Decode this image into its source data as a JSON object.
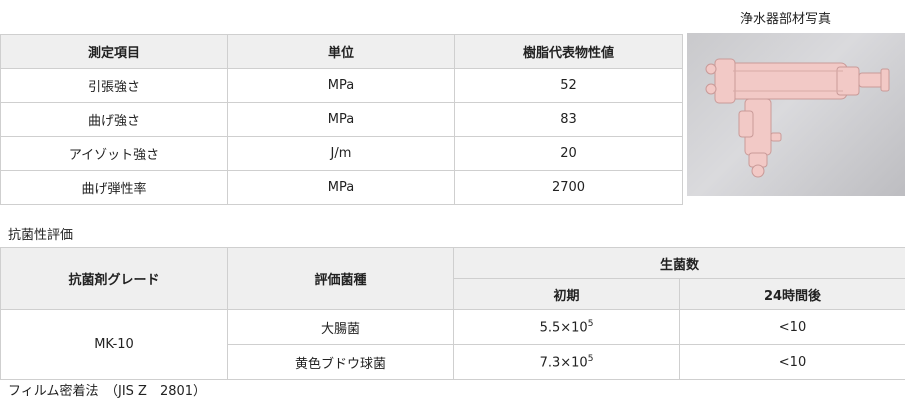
{
  "photo_caption": "浄水器部材写真",
  "properties_table": {
    "headers": [
      "測定項目",
      "単位",
      "樹脂代表物性値"
    ],
    "rows": [
      {
        "item": "引張強さ",
        "unit": "MPa",
        "value": "52"
      },
      {
        "item": "曲げ強さ",
        "unit": "MPa",
        "value": "83"
      },
      {
        "item": "アイゾット強さ",
        "unit": "J/m",
        "value": "20"
      },
      {
        "item": "曲げ弾性率",
        "unit": "MPa",
        "value": "2700"
      }
    ]
  },
  "antibacterial": {
    "title": "抗菌性評価",
    "headers": {
      "grade": "抗菌剤グレード",
      "species": "評価菌種",
      "count": "生菌数",
      "initial": "初期",
      "after24": "24時間後"
    },
    "grade": "MK-10",
    "rows": [
      {
        "species": "大腸菌",
        "initial_base": "5.5×10",
        "initial_exp": "5",
        "after24": "<10"
      },
      {
        "species": "黄色ブドウ球菌",
        "initial_base": "7.3×10",
        "initial_exp": "5",
        "after24": "<10"
      }
    ]
  },
  "footnote": "フィルム密着法　（JIS Z　2801）",
  "colors": {
    "header_bg": "#efefef",
    "border": "#cfcfcf",
    "part_pink": "#f2c9c6"
  }
}
